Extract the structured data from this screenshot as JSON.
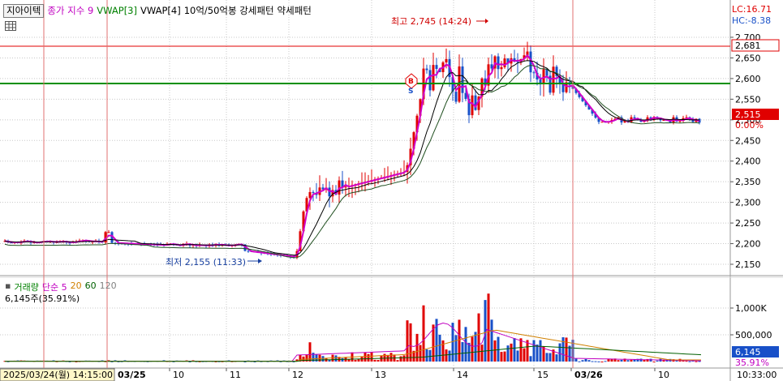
{
  "legend": {
    "stock_button": "지아이텍",
    "close_index": "종가 지수 9",
    "vwap3": "VWAP[3]",
    "vwap4": "VWAP[4]",
    "pattern_strong": "10억/50억봉 강세패턴",
    "pattern_weak": "약세패턴"
  },
  "price_axis": {
    "lc": "LC:16.71",
    "hc": "HC:-8.38",
    "ticks": [
      "2,700",
      "2,650",
      "2,600",
      "2,550",
      "2,500",
      "2,450",
      "2,400",
      "2,350",
      "2,300",
      "2,250",
      "2,200",
      "2,150"
    ],
    "tag_high": "2,681",
    "tag_last": "2,515",
    "tag_change": "0.00%"
  },
  "annotations": {
    "high": "최고 2,745 (14:24)",
    "low": "최저 2,155 (11:33)",
    "buy_marker": "B",
    "sell_marker": "S"
  },
  "volume_legend": {
    "volume": "거래량",
    "simple": "단순 5",
    "ma20": "20",
    "ma60": "60",
    "ma120": "120",
    "info": "6,145주(35.91%)"
  },
  "volume_axis": {
    "ticks": [
      "1,000K",
      "500,000"
    ],
    "tag_value": "6,145",
    "tag_pct": "35.91%"
  },
  "time_axis": {
    "cursor_date": "2025/03/24(월) 14:15:00",
    "labels": [
      "03/25",
      "10",
      "11",
      "12",
      "13",
      "14",
      "15",
      "03/26",
      "10"
    ],
    "clock": "10:33:00"
  },
  "colors": {
    "up": "#e00000",
    "down": "#1850c8",
    "close_index": "#d000c8",
    "vwap": "#000000",
    "green_line": "#009000",
    "red_line": "#e00000",
    "grid": "#c8c8c8",
    "tag_high": "#e00000",
    "tag_last": "#e00000",
    "tag_volume": "#1850c8"
  }
}
